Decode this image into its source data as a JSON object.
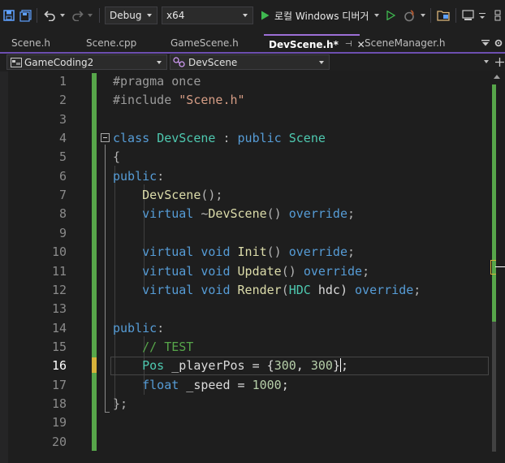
{
  "toolbar": {
    "config": "Debug",
    "platform": "x64",
    "run_label": "로컬 Windows 디버거",
    "colors": {
      "run": "#3fb950",
      "combo_bg": "#2b2b2b"
    }
  },
  "tabs": [
    {
      "label": "Scene.h",
      "active": false
    },
    {
      "label": "Scene.cpp",
      "active": false
    },
    {
      "label": "GameScene.h",
      "active": false
    },
    {
      "label": "DevScene.h*",
      "active": true
    },
    {
      "label": "SceneManager.h",
      "active": false
    }
  ],
  "navbar": {
    "project": "GameCoding2",
    "scope": "DevScene"
  },
  "editor": {
    "current_line": 16,
    "line_numbers": [
      "1",
      "2",
      "3",
      "4",
      "5",
      "6",
      "7",
      "8",
      "9",
      "10",
      "11",
      "12",
      "13",
      "14",
      "15",
      "16",
      "17",
      "18",
      "19",
      "20"
    ],
    "lines": [
      {
        "tokens": [
          {
            "t": "#pragma once",
            "c": "pp"
          }
        ]
      },
      {
        "tokens": [
          {
            "t": "#include ",
            "c": "pp"
          },
          {
            "t": "\"Scene.h\"",
            "c": "st"
          }
        ]
      },
      {
        "tokens": []
      },
      {
        "tokens": [
          {
            "t": "class",
            "c": "kw"
          },
          {
            "t": " ",
            "c": "id"
          },
          {
            "t": "DevScene",
            "c": "ty"
          },
          {
            "t": " : ",
            "c": "pu"
          },
          {
            "t": "public",
            "c": "kw"
          },
          {
            "t": " ",
            "c": "id"
          },
          {
            "t": "Scene",
            "c": "ty"
          }
        ]
      },
      {
        "tokens": [
          {
            "t": "{",
            "c": "pu"
          }
        ]
      },
      {
        "tokens": [
          {
            "t": "public",
            "c": "kw"
          },
          {
            "t": ":",
            "c": "pu"
          }
        ]
      },
      {
        "tokens": [
          {
            "t": "    ",
            "c": "id"
          },
          {
            "t": "DevScene",
            "c": "fn"
          },
          {
            "t": "();",
            "c": "pu"
          }
        ]
      },
      {
        "tokens": [
          {
            "t": "    ",
            "c": "id"
          },
          {
            "t": "virtual",
            "c": "kw"
          },
          {
            "t": " ~",
            "c": "pu"
          },
          {
            "t": "DevScene",
            "c": "fn"
          },
          {
            "t": "() ",
            "c": "pu"
          },
          {
            "t": "override",
            "c": "kw"
          },
          {
            "t": ";",
            "c": "pu"
          }
        ]
      },
      {
        "tokens": []
      },
      {
        "tokens": [
          {
            "t": "    ",
            "c": "id"
          },
          {
            "t": "virtual",
            "c": "kw"
          },
          {
            "t": " ",
            "c": "id"
          },
          {
            "t": "void",
            "c": "kw"
          },
          {
            "t": " ",
            "c": "id"
          },
          {
            "t": "Init",
            "c": "fn"
          },
          {
            "t": "() ",
            "c": "pu"
          },
          {
            "t": "override",
            "c": "kw"
          },
          {
            "t": ";",
            "c": "pu"
          }
        ]
      },
      {
        "tokens": [
          {
            "t": "    ",
            "c": "id"
          },
          {
            "t": "virtual",
            "c": "kw"
          },
          {
            "t": " ",
            "c": "id"
          },
          {
            "t": "void",
            "c": "kw"
          },
          {
            "t": " ",
            "c": "id"
          },
          {
            "t": "Update",
            "c": "fn"
          },
          {
            "t": "() ",
            "c": "pu"
          },
          {
            "t": "override",
            "c": "kw"
          },
          {
            "t": ";",
            "c": "pu"
          }
        ]
      },
      {
        "tokens": [
          {
            "t": "    ",
            "c": "id"
          },
          {
            "t": "virtual",
            "c": "kw"
          },
          {
            "t": " ",
            "c": "id"
          },
          {
            "t": "void",
            "c": "kw"
          },
          {
            "t": " ",
            "c": "id"
          },
          {
            "t": "Render",
            "c": "fn"
          },
          {
            "t": "(",
            "c": "pu"
          },
          {
            "t": "HDC",
            "c": "ty"
          },
          {
            "t": " hdc) ",
            "c": "id"
          },
          {
            "t": "override",
            "c": "kw"
          },
          {
            "t": ";",
            "c": "pu"
          }
        ]
      },
      {
        "tokens": []
      },
      {
        "tokens": [
          {
            "t": "public",
            "c": "kw"
          },
          {
            "t": ":",
            "c": "pu"
          }
        ]
      },
      {
        "tokens": [
          {
            "t": "    ",
            "c": "id"
          },
          {
            "t": "// TEST",
            "c": "cm"
          }
        ]
      },
      {
        "tokens": [
          {
            "t": "    ",
            "c": "id"
          },
          {
            "t": "Pos",
            "c": "ty"
          },
          {
            "t": " _playerPos = {",
            "c": "id"
          },
          {
            "t": "300",
            "c": "nu"
          },
          {
            "t": ", ",
            "c": "id"
          },
          {
            "t": "300",
            "c": "nu"
          },
          {
            "t": "}",
            "c": "id"
          },
          {
            "t": "|",
            "c": "caret"
          },
          {
            "t": ";",
            "c": "id"
          }
        ]
      },
      {
        "tokens": [
          {
            "t": "    ",
            "c": "id"
          },
          {
            "t": "float",
            "c": "kw"
          },
          {
            "t": " _speed = ",
            "c": "id"
          },
          {
            "t": "1000",
            "c": "nu"
          },
          {
            "t": ";",
            "c": "id"
          }
        ]
      },
      {
        "tokens": [
          {
            "t": "};",
            "c": "pu"
          }
        ]
      },
      {
        "tokens": []
      },
      {
        "tokens": []
      }
    ]
  }
}
